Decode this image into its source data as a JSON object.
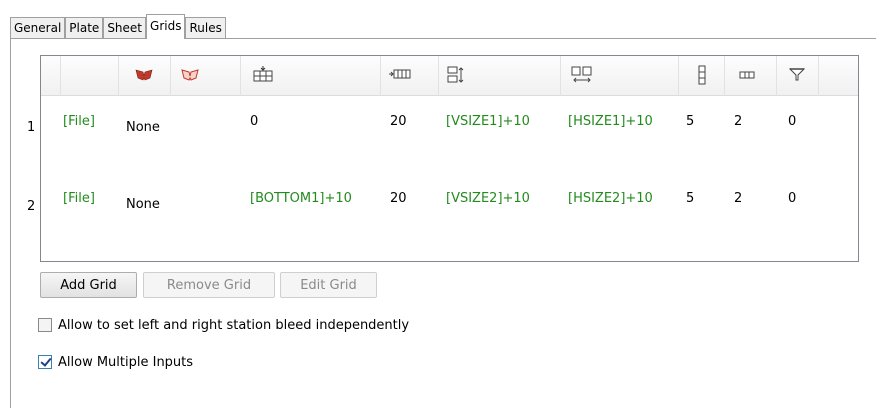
{
  "tabs": [
    {
      "label": "General"
    },
    {
      "label": "Plate"
    },
    {
      "label": "Sheet"
    },
    {
      "label": "Grids",
      "active": true
    },
    {
      "label": "Rules"
    }
  ],
  "grid": {
    "header_icons": [
      "red-shield-icon",
      "red-shield-outline-icon",
      "grid-position-icon",
      "columns-icon",
      "vertical-size-icon",
      "horizontal-size-icon",
      "vertical-bar-icon",
      "horizontal-bar-icon",
      "funnel-icon"
    ],
    "rows": [
      {
        "num": "1",
        "file": "[File]",
        "col2": "None",
        "col3": "0",
        "col4": "20",
        "col5": "[VSIZE1]+10",
        "col6": "[HSIZE1]+10",
        "col7": "5",
        "col8": "2",
        "col9": "0"
      },
      {
        "num": "2",
        "file": "[File]",
        "col2": "None",
        "col3": "[BOTTOM1]+10",
        "col4": "20",
        "col5": "[VSIZE2]+10",
        "col6": "[HSIZE2]+10",
        "col7": "5",
        "col8": "2",
        "col9": "0"
      }
    ]
  },
  "buttons": {
    "add": "Add Grid",
    "remove": "Remove Grid",
    "edit": "Edit Grid"
  },
  "options": {
    "bleed_label": "Allow to set left and right station bleed independently",
    "bleed_checked": false,
    "multi_label": "Allow Multiple Inputs",
    "multi_checked": true
  },
  "colors": {
    "accent_green": "#238b1e",
    "icon_red": "#c0392b"
  }
}
